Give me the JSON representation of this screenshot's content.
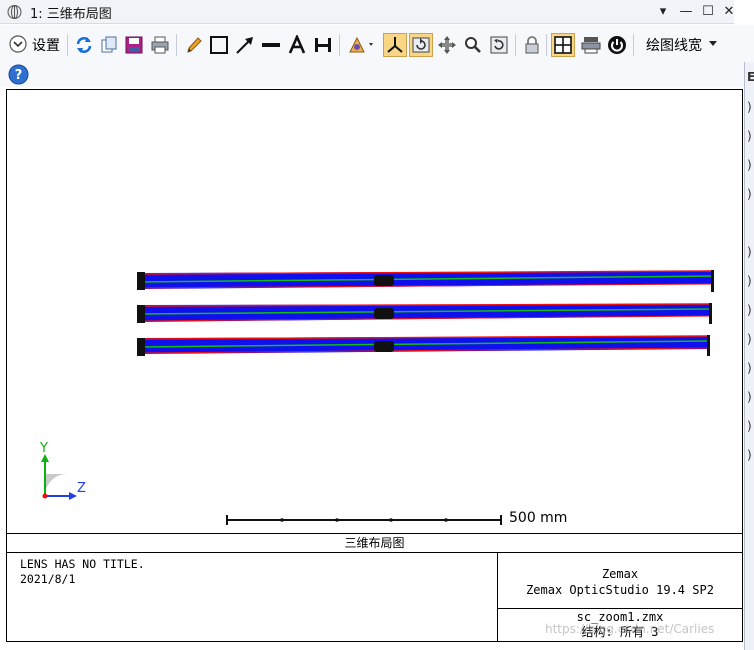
{
  "window": {
    "title": "1: 三维布局图",
    "buttons": [
      "▾",
      "—",
      "☐",
      "✕"
    ]
  },
  "toolbar": {
    "settings_label": "设置",
    "line_width_label": "绘图线宽",
    "tools": [
      "refresh-icon",
      "copy-icon",
      "save-icon",
      "print-icon",
      "pencil-icon",
      "rectangle-icon",
      "arrow-icon",
      "line-icon",
      "text-icon",
      "dimension-icon",
      "rotate-view-icon",
      "axes-icon",
      "reset-view-icon",
      "pan-icon",
      "zoom-icon",
      "undo-zoom-icon",
      "lock-icon",
      "grid-icon",
      "layers-icon",
      "power-icon",
      "help-icon"
    ]
  },
  "plot": {
    "caption": "三维布局图",
    "scale_bar_label": "500 mm",
    "axis_y_label": "Y",
    "axis_z_label": "Z",
    "info_left": [
      "LENS HAS NO TITLE.",
      "2021/8/1"
    ],
    "info_right_top": [
      "Zemax",
      "Zemax OpticStudio 19.4 SP2"
    ],
    "info_right_bottom": [
      "sc_zoom1.zmx",
      "结构: 所有 3"
    ],
    "colors": {
      "ray_blue": "#1010ee",
      "ray_green": "#10c010",
      "ray_red": "#ee1010",
      "lens_black": "#111111"
    }
  },
  "right_panel": {
    "cells": [
      ")",
      ")",
      ")",
      ")",
      ")",
      ")",
      ")",
      ")",
      ")",
      ")",
      ")",
      ")"
    ]
  },
  "watermark": "https://blog.csdn.net/Carlies"
}
